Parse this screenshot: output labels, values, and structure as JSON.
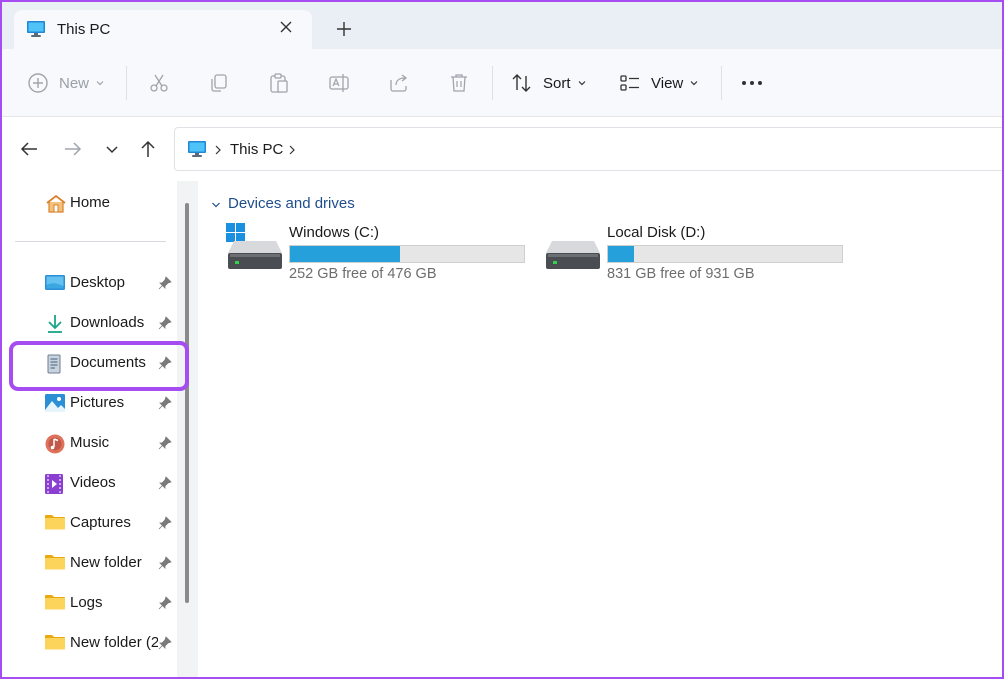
{
  "window": {
    "tab_title": "This PC",
    "tab_icon": "monitor-icon",
    "close_icon": "close-icon",
    "new_tab_icon": "plus-icon"
  },
  "toolbar": {
    "new_label": "New",
    "sort_label": "Sort",
    "view_label": "View",
    "more_icon": "more-icon",
    "icons": [
      "plus-circle-icon",
      "cut-icon",
      "copy-icon",
      "paste-icon",
      "rename-icon",
      "share-icon",
      "delete-icon",
      "sort-icon",
      "view-icon"
    ]
  },
  "address": {
    "path": "This PC",
    "icons": [
      "back-arrow-icon",
      "forward-arrow-icon",
      "recent-chevron-icon",
      "up-arrow-icon",
      "monitor-icon"
    ]
  },
  "sidebar": {
    "home": "Home",
    "items": [
      {
        "label": "Desktop",
        "icon": "desktop-icon"
      },
      {
        "label": "Downloads",
        "icon": "download-icon"
      },
      {
        "label": "Documents",
        "icon": "document-icon"
      },
      {
        "label": "Pictures",
        "icon": "pictures-icon"
      },
      {
        "label": "Music",
        "icon": "music-icon"
      },
      {
        "label": "Videos",
        "icon": "videos-icon"
      },
      {
        "label": "Captures",
        "icon": "folder-icon"
      },
      {
        "label": "New folder",
        "icon": "folder-icon"
      },
      {
        "label": "Logs",
        "icon": "folder-icon"
      },
      {
        "label": "New folder (2",
        "icon": "folder-icon"
      }
    ],
    "pin_icon": "pin-icon"
  },
  "content": {
    "group_title": "Devices and drives",
    "drives": [
      {
        "name": "Windows (C:)",
        "free": "252 GB free of 476 GB",
        "used_fraction": 0.47,
        "icon": "windows-drive-icon"
      },
      {
        "name": "Local Disk (D:)",
        "free": "831 GB free of 931 GB",
        "used_fraction": 0.11,
        "icon": "drive-icon"
      }
    ]
  },
  "colors": {
    "accent": "#26a0da",
    "highlight": "#a64df2",
    "group_title": "#1f4e8c"
  }
}
